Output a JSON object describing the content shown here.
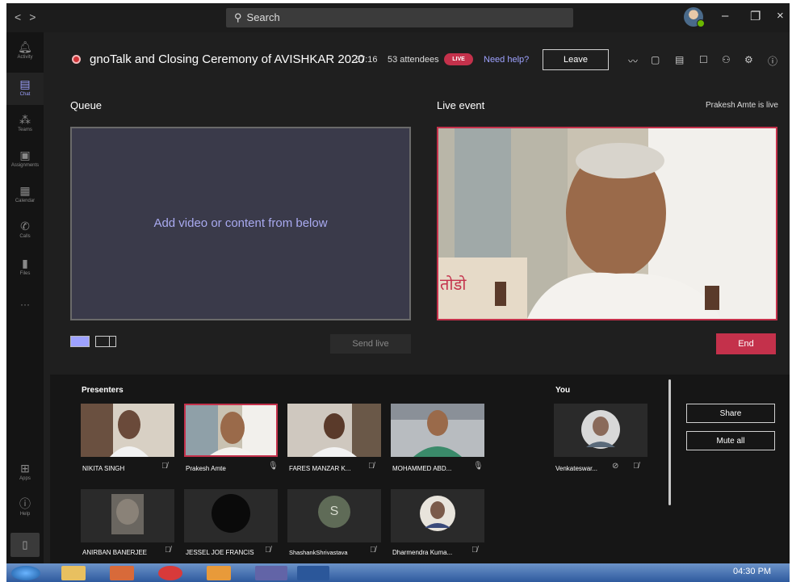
{
  "titlebar": {
    "nav_back": "<",
    "nav_forward": ">",
    "search_placeholder": "Search",
    "minimize": "–",
    "maximize": "❐",
    "close": "×"
  },
  "rail": {
    "items": [
      {
        "label": "Activity",
        "icon": "bell-icon"
      },
      {
        "label": "Chat",
        "icon": "chat-icon",
        "active": true
      },
      {
        "label": "Teams",
        "icon": "teams-icon"
      },
      {
        "label": "Assignments",
        "icon": "assignments-icon"
      },
      {
        "label": "Calendar",
        "icon": "calendar-icon"
      },
      {
        "label": "Calls",
        "icon": "phone-icon"
      },
      {
        "label": "Files",
        "icon": "file-icon"
      }
    ],
    "more": "···",
    "apps_label": "Apps",
    "help_label": "Help"
  },
  "meeting": {
    "title": "gnoTalk and Closing Ceremony of AVISHKAR 2020",
    "timer": "37:16",
    "attendees": "53 attendees",
    "live_badge": "LIVE",
    "need_help": "Need help?",
    "leave_label": "Leave"
  },
  "queue": {
    "heading": "Queue",
    "placeholder": "Add video or content from below",
    "send_live": "Send live"
  },
  "live_event": {
    "heading": "Live event",
    "status": "Prakesh Amte is live",
    "end_label": "End"
  },
  "presenters": {
    "heading": "Presenters",
    "items": [
      {
        "name": "NIKITA SINGH",
        "mic": "off"
      },
      {
        "name": "Prakesh Amte",
        "mic": "on"
      },
      {
        "name": "FARES MANZAR K...",
        "mic": "off"
      },
      {
        "name": "MOHAMMED ABD...",
        "mic": "on"
      },
      {
        "name": "ANIRBAN BANERJEE",
        "mic": "off"
      },
      {
        "name": "JESSEL JOE FRANCIS",
        "mic": "off"
      },
      {
        "name": "ShashankShrivastava",
        "mic": "off",
        "initial": "S"
      },
      {
        "name": "Dharmendra Kuma...",
        "mic": "off"
      }
    ]
  },
  "you": {
    "heading": "You",
    "name": "Venkateswar...",
    "share_label": "Share",
    "mute_all_label": "Mute all"
  },
  "taskbar": {
    "clock": "04:30 PM"
  },
  "colors": {
    "accent": "#9ea2ff",
    "live_red": "#c4314b",
    "background": "#1f1f1f"
  }
}
